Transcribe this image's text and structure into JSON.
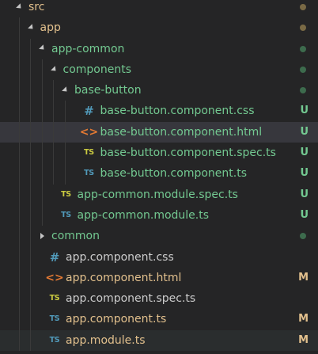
{
  "colors": {
    "untracked": "#73c991",
    "modified": "#e2c08d",
    "dot_modified": "#7a6a45",
    "dot_untracked": "#3d6b4d",
    "html_icon": "#e37933",
    "ts_icon": "#519aba",
    "spec_icon": "#cbcb41"
  },
  "explorer": {
    "rows": [
      {
        "label": "src",
        "kind": "folder",
        "expanded": true,
        "depth": 0,
        "status": "modified",
        "decoration": "dot"
      },
      {
        "label": "app",
        "kind": "folder",
        "expanded": true,
        "depth": 1,
        "status": "modified",
        "decoration": "dot"
      },
      {
        "label": "app-common",
        "kind": "folder",
        "expanded": true,
        "depth": 2,
        "status": "untracked",
        "decoration": "dot"
      },
      {
        "label": "components",
        "kind": "folder",
        "expanded": true,
        "depth": 3,
        "status": "untracked",
        "decoration": "dot"
      },
      {
        "label": "base-button",
        "kind": "folder",
        "expanded": true,
        "depth": 4,
        "status": "untracked",
        "decoration": "dot"
      },
      {
        "label": "base-button.component.css",
        "kind": "file",
        "icon": "css-hash-icon",
        "icon_glyph": "#",
        "depth": 5,
        "status": "untracked",
        "badge": "U"
      },
      {
        "label": "base-button.component.html",
        "kind": "file",
        "icon": "html-angle-icon",
        "icon_glyph": "<>",
        "depth": 5,
        "status": "untracked",
        "badge": "U",
        "selected": true
      },
      {
        "label": "base-button.component.spec.ts",
        "kind": "file",
        "icon": "spec-ts-icon",
        "icon_glyph": "TS",
        "depth": 5,
        "status": "untracked",
        "badge": "U"
      },
      {
        "label": "base-button.component.ts",
        "kind": "file",
        "icon": "typescript-icon",
        "icon_glyph": "TS",
        "depth": 5,
        "status": "untracked",
        "badge": "U"
      },
      {
        "label": "app-common.module.spec.ts",
        "kind": "file",
        "icon": "spec-ts-icon",
        "icon_glyph": "TS",
        "depth": 3,
        "status": "untracked",
        "badge": "U"
      },
      {
        "label": "app-common.module.ts",
        "kind": "file",
        "icon": "typescript-icon",
        "icon_glyph": "TS",
        "depth": 3,
        "status": "untracked",
        "badge": "U"
      },
      {
        "label": "common",
        "kind": "folder",
        "expanded": false,
        "depth": 2,
        "status": "untracked",
        "decoration": "dot"
      },
      {
        "label": "app.component.css",
        "kind": "file",
        "icon": "css-hash-icon",
        "icon_glyph": "#",
        "depth": 2,
        "status": "plain"
      },
      {
        "label": "app.component.html",
        "kind": "file",
        "icon": "html-angle-icon",
        "icon_glyph": "<>",
        "depth": 2,
        "status": "modified",
        "badge": "M"
      },
      {
        "label": "app.component.spec.ts",
        "kind": "file",
        "icon": "spec-ts-icon",
        "icon_glyph": "TS",
        "depth": 2,
        "status": "plain"
      },
      {
        "label": "app.component.ts",
        "kind": "file",
        "icon": "typescript-icon",
        "icon_glyph": "TS",
        "depth": 2,
        "status": "modified",
        "badge": "M"
      },
      {
        "label": "app.module.ts",
        "kind": "file",
        "icon": "typescript-icon",
        "icon_glyph": "TS",
        "depth": 2,
        "status": "modified",
        "badge": "M",
        "hovered": true
      }
    ]
  }
}
